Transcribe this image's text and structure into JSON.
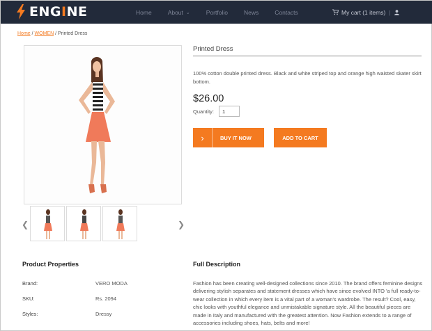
{
  "brand": {
    "logo_pre": "ENG",
    "logo_accent": "I",
    "logo_post": "NE",
    "accent_color": "#f47a20"
  },
  "nav": {
    "home": "Home",
    "about": "About",
    "portfolio": "Portfolio",
    "news": "News",
    "contacts": "Contacts"
  },
  "cart": {
    "label": "My cart (1 items)"
  },
  "breadcrumb": {
    "home": "Home",
    "women": "WOMEN",
    "current": "Printed Dress"
  },
  "product": {
    "title": "Printed Dress",
    "description": "100% cotton double printed dress. Black and white striped top and orange high waisted skater skirt bottom.",
    "price": "$26.00",
    "quantity_label": "Quantity:",
    "quantity_value": "1",
    "buy_now": "BUY IT NOW",
    "add_to_cart": "ADD TO CART"
  },
  "properties": {
    "heading": "Product Properties",
    "rows": [
      {
        "label": "Brand:",
        "value": "VERO MODA"
      },
      {
        "label": "SKU:",
        "value": "Rs. 2094"
      },
      {
        "label": "Styles:",
        "value": "Dressy"
      }
    ]
  },
  "full_description": {
    "heading": "Full Description",
    "text": "Fashion has been creating well-designed collections since 2010. The brand offers feminine designs delivering stylish separates and statement dresses which have since evolved INTO 'a full ready-to-wear collection in which every item is a vital part of a woman's wardrobe. The result? Cool, easy, chic looks with youthful elegance and unmistakable signature style. All the beautiful pieces are made in Italy and manufactured with the greatest attention. Now Fashion extends to a range of accessories including shoes, hats, belts and more!"
  }
}
